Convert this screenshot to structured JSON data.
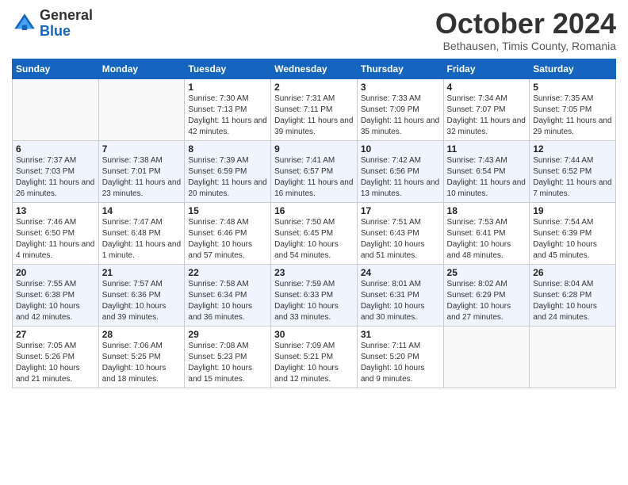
{
  "logo": {
    "general": "General",
    "blue": "Blue"
  },
  "header": {
    "month": "October 2024",
    "location": "Bethausen, Timis County, Romania"
  },
  "weekdays": [
    "Sunday",
    "Monday",
    "Tuesday",
    "Wednesday",
    "Thursday",
    "Friday",
    "Saturday"
  ],
  "weeks": [
    [
      {
        "day": "",
        "info": ""
      },
      {
        "day": "",
        "info": ""
      },
      {
        "day": "1",
        "info": "Sunrise: 7:30 AM\nSunset: 7:13 PM\nDaylight: 11 hours and 42 minutes."
      },
      {
        "day": "2",
        "info": "Sunrise: 7:31 AM\nSunset: 7:11 PM\nDaylight: 11 hours and 39 minutes."
      },
      {
        "day": "3",
        "info": "Sunrise: 7:33 AM\nSunset: 7:09 PM\nDaylight: 11 hours and 35 minutes."
      },
      {
        "day": "4",
        "info": "Sunrise: 7:34 AM\nSunset: 7:07 PM\nDaylight: 11 hours and 32 minutes."
      },
      {
        "day": "5",
        "info": "Sunrise: 7:35 AM\nSunset: 7:05 PM\nDaylight: 11 hours and 29 minutes."
      }
    ],
    [
      {
        "day": "6",
        "info": "Sunrise: 7:37 AM\nSunset: 7:03 PM\nDaylight: 11 hours and 26 minutes."
      },
      {
        "day": "7",
        "info": "Sunrise: 7:38 AM\nSunset: 7:01 PM\nDaylight: 11 hours and 23 minutes."
      },
      {
        "day": "8",
        "info": "Sunrise: 7:39 AM\nSunset: 6:59 PM\nDaylight: 11 hours and 20 minutes."
      },
      {
        "day": "9",
        "info": "Sunrise: 7:41 AM\nSunset: 6:57 PM\nDaylight: 11 hours and 16 minutes."
      },
      {
        "day": "10",
        "info": "Sunrise: 7:42 AM\nSunset: 6:56 PM\nDaylight: 11 hours and 13 minutes."
      },
      {
        "day": "11",
        "info": "Sunrise: 7:43 AM\nSunset: 6:54 PM\nDaylight: 11 hours and 10 minutes."
      },
      {
        "day": "12",
        "info": "Sunrise: 7:44 AM\nSunset: 6:52 PM\nDaylight: 11 hours and 7 minutes."
      }
    ],
    [
      {
        "day": "13",
        "info": "Sunrise: 7:46 AM\nSunset: 6:50 PM\nDaylight: 11 hours and 4 minutes."
      },
      {
        "day": "14",
        "info": "Sunrise: 7:47 AM\nSunset: 6:48 PM\nDaylight: 11 hours and 1 minute."
      },
      {
        "day": "15",
        "info": "Sunrise: 7:48 AM\nSunset: 6:46 PM\nDaylight: 10 hours and 57 minutes."
      },
      {
        "day": "16",
        "info": "Sunrise: 7:50 AM\nSunset: 6:45 PM\nDaylight: 10 hours and 54 minutes."
      },
      {
        "day": "17",
        "info": "Sunrise: 7:51 AM\nSunset: 6:43 PM\nDaylight: 10 hours and 51 minutes."
      },
      {
        "day": "18",
        "info": "Sunrise: 7:53 AM\nSunset: 6:41 PM\nDaylight: 10 hours and 48 minutes."
      },
      {
        "day": "19",
        "info": "Sunrise: 7:54 AM\nSunset: 6:39 PM\nDaylight: 10 hours and 45 minutes."
      }
    ],
    [
      {
        "day": "20",
        "info": "Sunrise: 7:55 AM\nSunset: 6:38 PM\nDaylight: 10 hours and 42 minutes."
      },
      {
        "day": "21",
        "info": "Sunrise: 7:57 AM\nSunset: 6:36 PM\nDaylight: 10 hours and 39 minutes."
      },
      {
        "day": "22",
        "info": "Sunrise: 7:58 AM\nSunset: 6:34 PM\nDaylight: 10 hours and 36 minutes."
      },
      {
        "day": "23",
        "info": "Sunrise: 7:59 AM\nSunset: 6:33 PM\nDaylight: 10 hours and 33 minutes."
      },
      {
        "day": "24",
        "info": "Sunrise: 8:01 AM\nSunset: 6:31 PM\nDaylight: 10 hours and 30 minutes."
      },
      {
        "day": "25",
        "info": "Sunrise: 8:02 AM\nSunset: 6:29 PM\nDaylight: 10 hours and 27 minutes."
      },
      {
        "day": "26",
        "info": "Sunrise: 8:04 AM\nSunset: 6:28 PM\nDaylight: 10 hours and 24 minutes."
      }
    ],
    [
      {
        "day": "27",
        "info": "Sunrise: 7:05 AM\nSunset: 5:26 PM\nDaylight: 10 hours and 21 minutes."
      },
      {
        "day": "28",
        "info": "Sunrise: 7:06 AM\nSunset: 5:25 PM\nDaylight: 10 hours and 18 minutes."
      },
      {
        "day": "29",
        "info": "Sunrise: 7:08 AM\nSunset: 5:23 PM\nDaylight: 10 hours and 15 minutes."
      },
      {
        "day": "30",
        "info": "Sunrise: 7:09 AM\nSunset: 5:21 PM\nDaylight: 10 hours and 12 minutes."
      },
      {
        "day": "31",
        "info": "Sunrise: 7:11 AM\nSunset: 5:20 PM\nDaylight: 10 hours and 9 minutes."
      },
      {
        "day": "",
        "info": ""
      },
      {
        "day": "",
        "info": ""
      }
    ]
  ]
}
